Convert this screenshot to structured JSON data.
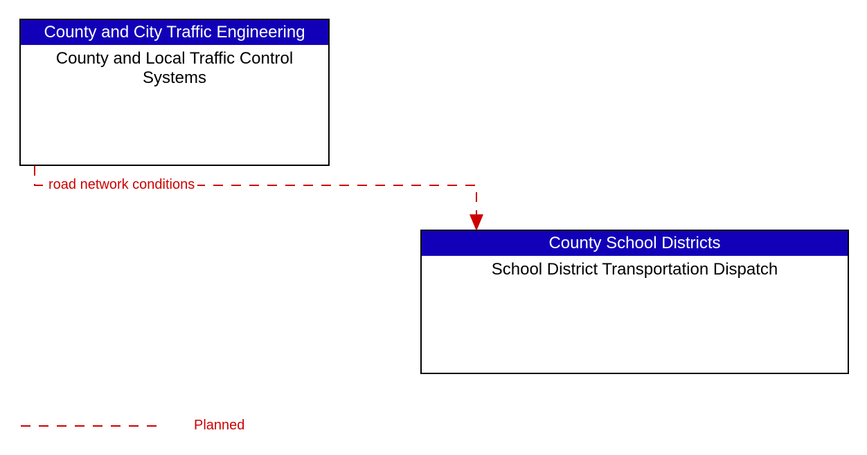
{
  "boxes": {
    "top": {
      "header": "County and City Traffic Engineering",
      "body": "County and Local Traffic Control Systems"
    },
    "bottom": {
      "header": "County School Districts",
      "body": "School District Transportation Dispatch"
    }
  },
  "flow": {
    "label": "road network conditions"
  },
  "legend": {
    "planned": "Planned"
  },
  "colors": {
    "header_bg": "#1200b8",
    "flow": "#cc0000"
  }
}
